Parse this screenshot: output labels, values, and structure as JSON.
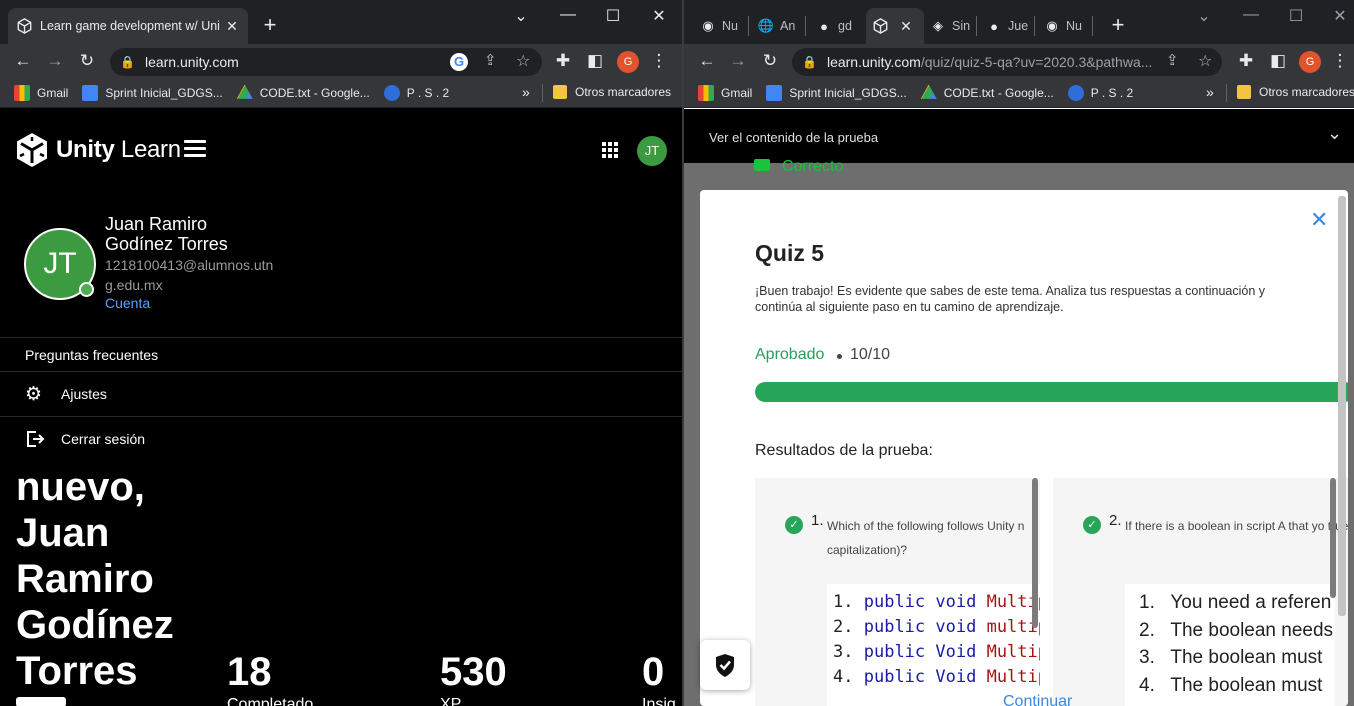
{
  "left_window": {
    "tab": {
      "title": "Learn game development w/ Uni"
    },
    "address": {
      "url": "learn.unity.com"
    },
    "profile_initial": "G",
    "bookmarks": [
      "Gmail",
      "Sprint Inicial_GDGS...",
      "CODE.txt - Google...",
      "P . S . 2"
    ],
    "bookmarks_folder": "Otros marcadores",
    "brand": {
      "bold": "Unity",
      "light": "Learn"
    },
    "user": {
      "initials": "JT",
      "name": "Juan Ramiro Godínez Torres",
      "email": "1218100413@alumnos.utng.edu.mx",
      "account_link": "Cuenta"
    },
    "menu": {
      "faq": "Preguntas frecuentes",
      "settings": "Ajustes",
      "logout": "Cerrar sesión"
    },
    "welcome": "nuevo, Juan Ramiro Godínez Torres",
    "stats": [
      {
        "value": "18",
        "label": "Completado"
      },
      {
        "value": "530",
        "label": "XP"
      },
      {
        "value": "0",
        "label": "Insig"
      }
    ]
  },
  "right_window": {
    "tabs": [
      "Nu",
      "An",
      "gd",
      "",
      "Sin",
      "Jue",
      "Nu"
    ],
    "address": {
      "host": "learn.unity.com",
      "path": "/quiz/quiz-5-qa?uv=2020.3&pathwa..."
    },
    "profile_initial": "G",
    "bookmarks": [
      "Gmail",
      "Sprint Inicial_GDGS...",
      "CODE.txt - Google...",
      "P . S . 2"
    ],
    "bookmarks_folder": "Otros marcadores",
    "quiz_content_bar": "Ver el contenido de la prueba",
    "behind_text": "Correcto",
    "modal": {
      "title": "Quiz 5",
      "description": "¡Buen trabajo! Es evidente que sabes de este tema. Analiza tus respuestas a continuación y continúa al siguiente paso en tu camino de aprendizaje.",
      "status": "Aprobado",
      "score": "10/10",
      "progress": 1.0,
      "results_title": "Resultados de la prueba:",
      "continue": "Continuar",
      "questions": [
        {
          "number": "1.",
          "text": "Which of the following follows Unity n capitalization)?",
          "options": [
            {
              "n": "1.",
              "kw": "public void",
              "fn": "Multip"
            },
            {
              "n": "2.",
              "kw": "public void",
              "fn": "multip"
            },
            {
              "n": "3.",
              "kw": "public Void",
              "fn": "Multip"
            },
            {
              "n": "4.",
              "kw": "public Void",
              "fn": "Multip"
            }
          ]
        },
        {
          "number": "2.",
          "text": "If there is a boolean in script A that yo true:",
          "options": [
            {
              "n": "1.",
              "t": "You need a referen"
            },
            {
              "n": "2.",
              "t": "The boolean needs"
            },
            {
              "n": "3.",
              "t": "The boolean must"
            },
            {
              "n": "4.",
              "t": "The boolean must"
            }
          ]
        }
      ]
    }
  },
  "colors": {
    "accent_green": "#27a659",
    "link_blue": "#3a8ae0",
    "avatar_green": "#3c9b40"
  }
}
